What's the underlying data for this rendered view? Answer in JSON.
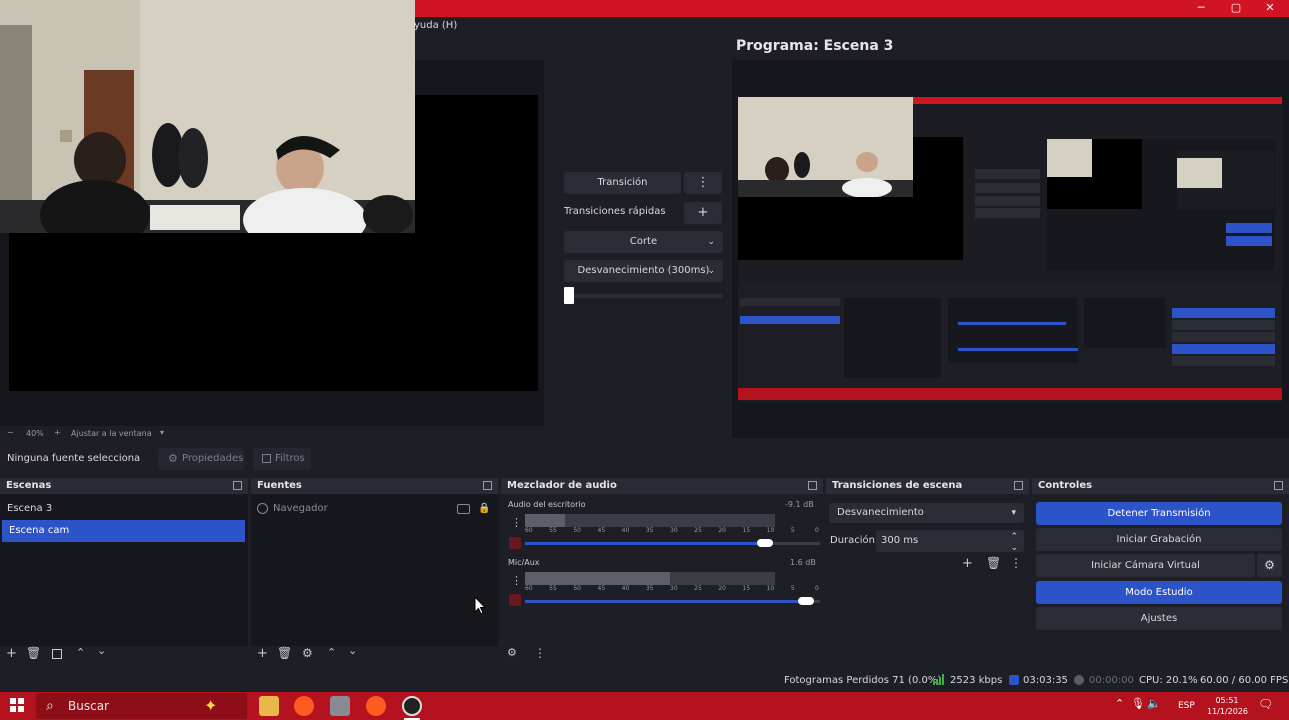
{
  "window": {
    "menu_partial": "yuda (H)",
    "minimize": "─",
    "maximize": "▢",
    "close": "✕"
  },
  "preview": {
    "zoom_minus": "−",
    "zoom": "40%",
    "zoom_plus": "+",
    "fit_label": "Ajustar a la ventana",
    "fit_arrow": "▾"
  },
  "program": {
    "title": "Programa: Escena 3"
  },
  "transitions_panel": {
    "transition_label": "Transición",
    "menu_glyph": "⋮",
    "quick_label": "Transiciones rápidas",
    "add_glyph": "+",
    "items": [
      "Corte",
      "Desvanecimiento (300ms)"
    ]
  },
  "source_toolbar": {
    "no_source": "Ninguna fuente selecciona",
    "properties": "Propiedades",
    "filters": "Filtros"
  },
  "scenes": {
    "title": "Escenas",
    "items": [
      "Escena 3",
      "Escena cam"
    ],
    "selected_index": 1
  },
  "sources": {
    "title": "Fuentes",
    "items": [
      "Navegador"
    ]
  },
  "mixer": {
    "title": "Mezclador de audio",
    "channels": [
      {
        "name": "Audio del escritorio",
        "db": "-9.1 dB",
        "volume": 0.84
      },
      {
        "name": "Mic/Aux",
        "db": "1.6 dB",
        "volume": 0.98
      }
    ],
    "ticks": [
      "60",
      "55",
      "50",
      "45",
      "40",
      "35",
      "30",
      "25",
      "20",
      "15",
      "10",
      "5",
      "0"
    ]
  },
  "scene_transitions": {
    "title": "Transiciones de escena",
    "selected": "Desvanecimiento",
    "duration_label": "Duración",
    "duration_value": "300 ms"
  },
  "controls": {
    "title": "Controles",
    "stop_stream": "Detener Transmisión",
    "start_record": "Iniciar Grabación",
    "virtual_cam": "Iniciar Cámara Virtual",
    "studio_mode": "Modo Estudio",
    "settings": "Ajustes"
  },
  "status": {
    "dropped": "Fotogramas Perdidos 71 (0.0%)",
    "bitrate": "2523 kbps",
    "stream_time": "03:03:35",
    "record_time": "00:00:00",
    "cpu": "CPU: 20.1%",
    "fps": "60.00 / 60.00 FPS"
  },
  "taskbar": {
    "search": "Buscar",
    "lang": "ESP",
    "time": "05:51",
    "date": "11/1/2026"
  },
  "colors": {
    "accent_blue": "#2c54c8",
    "title_red": "#d01422",
    "taskbar_red": "#b4121e"
  }
}
